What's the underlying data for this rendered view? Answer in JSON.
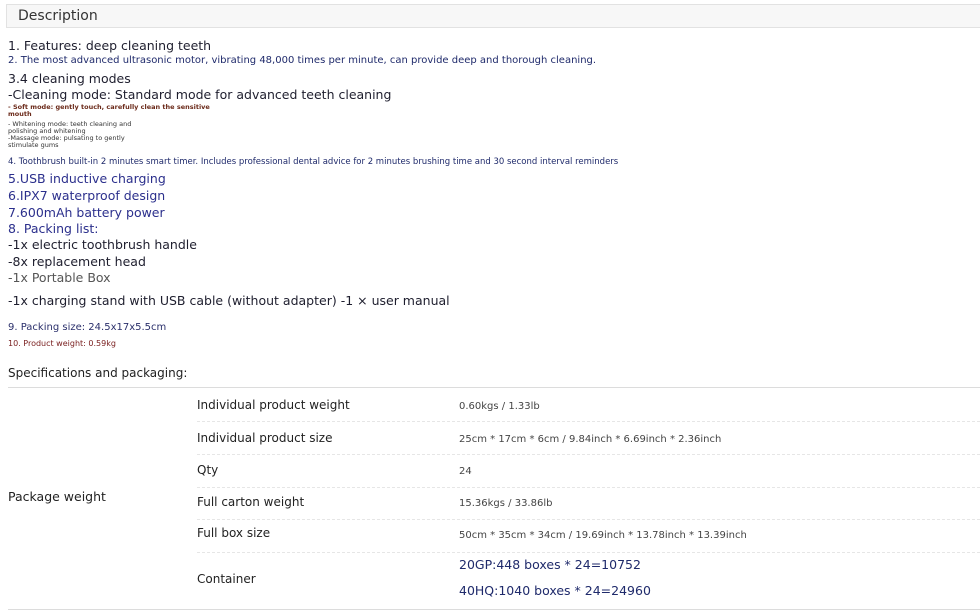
{
  "tab": {
    "label": "Description"
  },
  "description": {
    "l1": "1. Features: deep cleaning teeth",
    "l2": "2. The most advanced ultrasonic motor, vibrating 48,000 times per minute, can provide deep and thorough cleaning.",
    "l3": "3.4 cleaning modes",
    "l4": "-Cleaning mode: Standard mode for advanced teeth cleaning",
    "l5a": "- Soft mode: gently touch, carefully clean the sensitive",
    "l5b": "mouth",
    "l6a": "- Whitening mode: teeth cleaning and",
    "l6b": "polishing and whitening",
    "l7a": "-Massage mode: pulsating to gently",
    "l7b": "stimulate gums",
    "l8": "4. Toothbrush built-in 2 minutes smart timer. Includes professional dental advice for 2 minutes brushing time and 30 second interval reminders",
    "l9": "5.USB inductive charging",
    "l10": "6.IPX7 waterproof design",
    "l11": "7.600mAh battery power",
    "l12": "8. Packing list:",
    "l13": "-1x electric toothbrush handle",
    "l14": "-8x replacement head",
    "l15": "-1x Portable Box",
    "l16": "-1x charging stand with USB cable (without adapter) -1 × user manual",
    "l17": "9. Packing size: 24.5x17x5.5cm",
    "l18": "10. Product weight: 0.59kg"
  },
  "specs": {
    "title": "Specifications and packaging:",
    "group_label": "Package weight",
    "rows": [
      {
        "key": "Individual product weight",
        "value": "0.60kgs / 1.33lb"
      },
      {
        "key": "Individual product size",
        "value": "25cm * 17cm * 6cm / 9.84inch * 6.69inch * 2.36inch"
      },
      {
        "key": "Qty",
        "value": "24"
      },
      {
        "key": "Full carton weight",
        "value": "15.36kgs / 33.86lb"
      },
      {
        "key": "Full box size",
        "value": "50cm * 35cm * 34cm / 19.69inch * 13.78inch * 13.39inch"
      },
      {
        "key": "Container",
        "value": "20GP:448 boxes * 24=10752",
        "value2": "40HQ:1040 boxes * 24=24960"
      }
    ]
  }
}
